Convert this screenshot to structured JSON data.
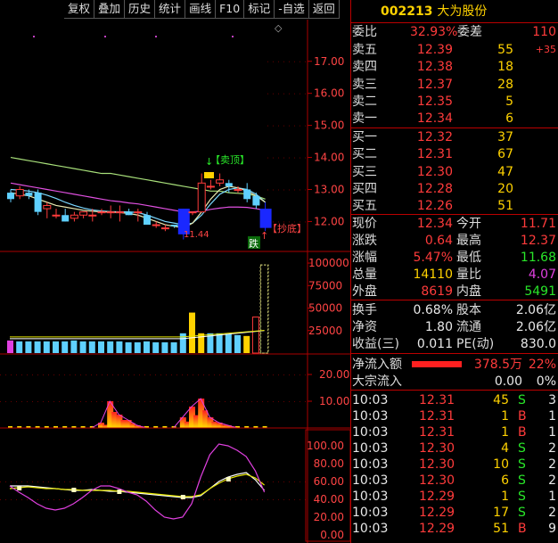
{
  "toolbar": {
    "buttons": [
      "复权",
      "叠加",
      "历史",
      "统计",
      "画线",
      "F10",
      "标记",
      "-自选",
      "返回"
    ]
  },
  "stock": {
    "code": "002213",
    "name": "大为股份"
  },
  "chart_data": [
    {
      "type": "candlestick",
      "y_ticks": [
        "17.00",
        "16.00",
        "15.00",
        "14.00",
        "13.00",
        "12.00"
      ],
      "ylim": [
        11.4,
        17.8
      ],
      "annotations": [
        "【卖顶】",
        "【抄底】",
        "11.44",
        "跌",
        "◇"
      ],
      "candles": [
        {
          "o": 12.9,
          "h": 13.0,
          "l": 12.6,
          "c": 12.7
        },
        {
          "o": 12.8,
          "h": 13.1,
          "l": 12.7,
          "c": 13.0
        },
        {
          "o": 12.9,
          "h": 13.0,
          "l": 12.7,
          "c": 12.8
        },
        {
          "o": 12.9,
          "h": 13.0,
          "l": 12.2,
          "c": 12.3
        },
        {
          "o": 12.4,
          "h": 12.6,
          "l": 12.1,
          "c": 12.5
        },
        {
          "o": 12.2,
          "h": 12.4,
          "l": 12.1,
          "c": 12.2
        },
        {
          "o": 12.2,
          "h": 12.4,
          "l": 12.0,
          "c": 12.0
        },
        {
          "o": 12.1,
          "h": 12.3,
          "l": 12.0,
          "c": 12.2
        },
        {
          "o": 12.2,
          "h": 12.3,
          "l": 12.1,
          "c": 12.3
        },
        {
          "o": 12.2,
          "h": 12.4,
          "l": 12.0,
          "c": 12.2
        },
        {
          "o": 12.3,
          "h": 12.4,
          "l": 12.2,
          "c": 12.3
        },
        {
          "o": 12.3,
          "h": 12.5,
          "l": 12.1,
          "c": 12.3
        },
        {
          "o": 12.3,
          "h": 12.5,
          "l": 12.0,
          "c": 12.3
        },
        {
          "o": 12.3,
          "h": 12.4,
          "l": 12.2,
          "c": 12.2
        },
        {
          "o": 12.3,
          "h": 12.4,
          "l": 12.0,
          "c": 12.3
        },
        {
          "o": 12.2,
          "h": 12.3,
          "l": 11.9,
          "c": 11.9
        },
        {
          "o": 11.9,
          "h": 12.0,
          "l": 11.8,
          "c": 11.9
        },
        {
          "o": 11.8,
          "h": 11.9,
          "l": 11.7,
          "c": 11.8
        },
        {
          "o": 11.9,
          "h": 11.9,
          "l": 11.8,
          "c": 11.85
        },
        {
          "o": 12.4,
          "h": 12.4,
          "l": 11.44,
          "c": 11.6
        },
        {
          "o": 12.3,
          "h": 12.3,
          "l": 12.2,
          "c": 12.3
        },
        {
          "o": 12.3,
          "h": 13.5,
          "l": 12.3,
          "c": 13.2
        },
        {
          "o": 13.1,
          "h": 13.3,
          "l": 13.0,
          "c": 13.1
        },
        {
          "o": 13.2,
          "h": 13.5,
          "l": 13.1,
          "c": 13.3
        },
        {
          "o": 13.2,
          "h": 13.3,
          "l": 12.9,
          "c": 13.1
        },
        {
          "o": 13.0,
          "h": 13.1,
          "l": 12.9,
          "c": 13.0
        },
        {
          "o": 13.0,
          "h": 13.2,
          "l": 12.6,
          "c": 12.7
        },
        {
          "o": 12.8,
          "h": 12.9,
          "l": 12.4,
          "c": 12.5
        },
        {
          "o": 12.4,
          "h": 12.6,
          "l": 11.7,
          "c": 11.8
        }
      ],
      "ma_lines": [
        {
          "color": "#a8e07a",
          "values": [
            14.0,
            13.95,
            13.9,
            13.85,
            13.8,
            13.75,
            13.7,
            13.65,
            13.6,
            13.55,
            13.5,
            13.5,
            13.45,
            13.4,
            13.35,
            13.3,
            13.25,
            13.2,
            13.15,
            13.1,
            13.05,
            13.0,
            12.95,
            12.95,
            12.9,
            12.88,
            12.86,
            12.8,
            12.7
          ]
        },
        {
          "color": "#e050e0",
          "values": [
            13.2,
            13.15,
            13.1,
            13.05,
            13.0,
            12.95,
            12.9,
            12.85,
            12.8,
            12.75,
            12.7,
            12.65,
            12.62,
            12.58,
            12.55,
            12.5,
            12.45,
            12.4,
            12.35,
            12.3,
            12.3,
            12.32,
            12.38,
            12.42,
            12.45,
            12.45,
            12.44,
            12.4,
            12.35
          ]
        },
        {
          "color": "#7ad7ff",
          "values": [
            13.0,
            12.98,
            12.95,
            12.9,
            12.82,
            12.72,
            12.6,
            12.5,
            12.42,
            12.36,
            12.33,
            12.31,
            12.3,
            12.3,
            12.28,
            12.2,
            12.1,
            12.0,
            11.95,
            11.9,
            11.95,
            12.2,
            12.55,
            12.85,
            13.0,
            13.05,
            13.0,
            12.85,
            12.6
          ]
        },
        {
          "color": "#e8e8b0",
          "values": [
            12.9,
            12.85,
            12.8,
            12.7,
            12.6,
            12.5,
            12.45,
            12.4,
            12.35,
            12.32,
            12.3,
            12.3,
            12.28,
            12.25,
            12.2,
            12.1,
            12.0,
            11.9,
            11.85,
            11.8,
            11.95,
            12.3,
            12.7,
            13.0,
            13.1,
            13.05,
            12.95,
            12.8,
            12.6
          ]
        }
      ]
    },
    {
      "type": "bar",
      "y_ticks": [
        "100000",
        "75000",
        "50000",
        "25000"
      ],
      "ylim": [
        0,
        105000
      ],
      "values": [
        14000,
        13000,
        13000,
        13000,
        13000,
        13000,
        13000,
        14000,
        13000,
        13000,
        13000,
        13000,
        13000,
        12000,
        12000,
        13000,
        12000,
        12000,
        12000,
        22000,
        45000,
        22000,
        22000,
        22000,
        21000,
        20000,
        19000,
        40000,
        98000
      ]
    },
    {
      "type": "bar",
      "y_ticks": [
        "20.00",
        "10.00"
      ],
      "ylim": [
        0,
        25
      ],
      "values": [
        0,
        0,
        0,
        0,
        0,
        0,
        0,
        0,
        0,
        0,
        2,
        10,
        5,
        3,
        1,
        0,
        0,
        0,
        0,
        4,
        8,
        11,
        4,
        2,
        1,
        0,
        0,
        0,
        0
      ]
    },
    {
      "type": "line",
      "y_ticks": [
        "100.00",
        "80.00",
        "60.00",
        "40.00",
        "20.00",
        "0.00"
      ],
      "ylim": [
        -5,
        115
      ],
      "series": [
        {
          "color": "#ffffff",
          "values": [
            55,
            55,
            55,
            54,
            53,
            52,
            51,
            50,
            50,
            51,
            50,
            49,
            49,
            48,
            47,
            46,
            45,
            44,
            43,
            42,
            42,
            44,
            52,
            60,
            65,
            68,
            70,
            62,
            50
          ]
        },
        {
          "color": "#e6e600",
          "values": [
            52,
            53,
            54,
            53,
            52,
            52,
            51,
            51,
            50,
            50,
            50,
            50,
            49,
            49,
            48,
            47,
            46,
            45,
            44,
            43,
            43,
            45,
            52,
            58,
            63,
            66,
            68,
            64,
            56
          ]
        },
        {
          "color": "#e040e0",
          "values": [
            55,
            48,
            42,
            35,
            30,
            28,
            30,
            35,
            42,
            50,
            55,
            55,
            52,
            48,
            45,
            38,
            28,
            20,
            18,
            20,
            35,
            65,
            90,
            102,
            100,
            95,
            88,
            72,
            48
          ]
        }
      ]
    }
  ],
  "quote": {
    "weibi_label": "委比",
    "weibi_value": "32.93%",
    "weicha_label": "委差",
    "weicha_value": "110",
    "asks": [
      {
        "label": "卖五",
        "price": "12.39",
        "vol": "55",
        "extra": "+35"
      },
      {
        "label": "卖四",
        "price": "12.38",
        "vol": "18",
        "extra": ""
      },
      {
        "label": "卖三",
        "price": "12.37",
        "vol": "28",
        "extra": ""
      },
      {
        "label": "卖二",
        "price": "12.35",
        "vol": "5",
        "extra": ""
      },
      {
        "label": "卖一",
        "price": "12.34",
        "vol": "6",
        "extra": ""
      }
    ],
    "bids": [
      {
        "label": "买一",
        "price": "12.32",
        "vol": "37"
      },
      {
        "label": "买二",
        "price": "12.31",
        "vol": "67"
      },
      {
        "label": "买三",
        "price": "12.30",
        "vol": "47"
      },
      {
        "label": "买四",
        "price": "12.28",
        "vol": "20"
      },
      {
        "label": "买五",
        "price": "12.26",
        "vol": "51"
      }
    ],
    "stats": [
      {
        "l1": "现价",
        "v1": "12.34",
        "c1": "red",
        "l2": "今开",
        "v2": "11.71",
        "c2": "red"
      },
      {
        "l1": "涨跌",
        "v1": "0.64",
        "c1": "red",
        "l2": "最高",
        "v2": "12.37",
        "c2": "red"
      },
      {
        "l1": "涨幅",
        "v1": "5.47%",
        "c1": "red",
        "l2": "最低",
        "v2": "11.68",
        "c2": "grn"
      },
      {
        "l1": "总量",
        "v1": "14110",
        "c1": "yel",
        "l2": "量比",
        "v2": "4.07",
        "c2": "mag"
      },
      {
        "l1": "外盘",
        "v1": "8619",
        "c1": "red",
        "l2": "内盘",
        "v2": "5491",
        "c2": "grn"
      }
    ],
    "finance": [
      {
        "l1": "换手",
        "v1": "0.68%",
        "l2": "股本",
        "v2": "2.06亿"
      },
      {
        "l1": "净资",
        "v1": "1.80",
        "l2": "流通",
        "v2": "2.06亿"
      },
      {
        "l1": "收益(三)",
        "v1": "0.011",
        "l2": "PE(动)",
        "v2": "830.0"
      }
    ],
    "netflow_label": "净流入额",
    "netflow_value": "378.5万",
    "netflow_pct": "22%",
    "block_label": "大宗流入",
    "block_value": "0.00",
    "block_pct": "0%"
  },
  "ticks": [
    {
      "time": "10:03",
      "price": "12.31",
      "vol": "45",
      "side": "S",
      "n": "3"
    },
    {
      "time": "10:03",
      "price": "12.31",
      "vol": "1",
      "side": "B",
      "n": "1"
    },
    {
      "time": "10:03",
      "price": "12.31",
      "vol": "1",
      "side": "B",
      "n": "1"
    },
    {
      "time": "10:03",
      "price": "12.30",
      "vol": "4",
      "side": "S",
      "n": "2"
    },
    {
      "time": "10:03",
      "price": "12.30",
      "vol": "10",
      "side": "S",
      "n": "2"
    },
    {
      "time": "10:03",
      "price": "12.30",
      "vol": "6",
      "side": "S",
      "n": "2"
    },
    {
      "time": "10:03",
      "price": "12.29",
      "vol": "1",
      "side": "S",
      "n": "1"
    },
    {
      "time": "10:03",
      "price": "12.29",
      "vol": "17",
      "side": "S",
      "n": "2"
    },
    {
      "time": "10:03",
      "price": "12.29",
      "vol": "51",
      "side": "B",
      "n": "9"
    }
  ]
}
